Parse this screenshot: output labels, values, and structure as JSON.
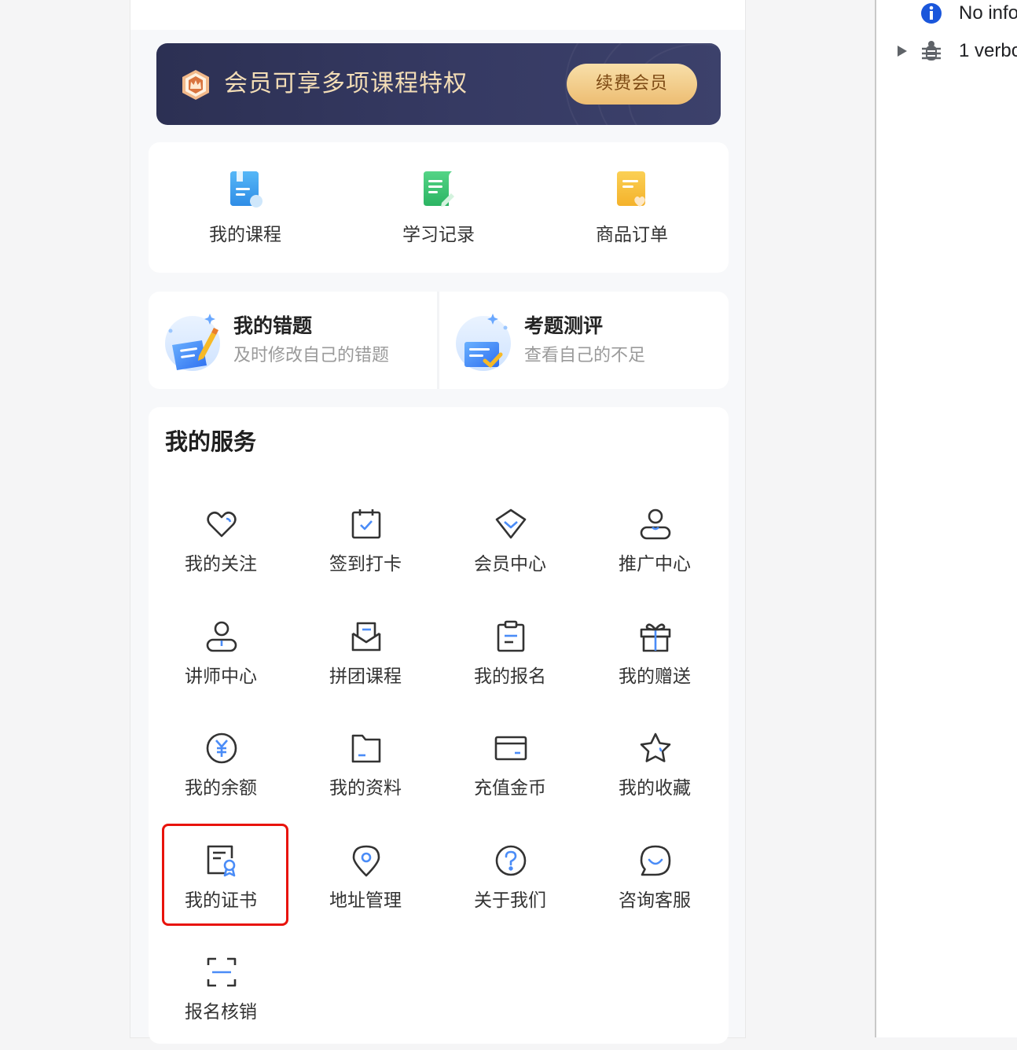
{
  "member_banner": {
    "text": "会员可享多项课程特权",
    "button": "续费会员"
  },
  "quick_entries": [
    {
      "label": "我的课程",
      "icon": "course-book-icon",
      "color": "#3aa0ee"
    },
    {
      "label": "学习记录",
      "icon": "study-record-icon",
      "color": "#3fc271"
    },
    {
      "label": "商品订单",
      "icon": "goods-order-icon",
      "color": "#f7bd3c"
    }
  ],
  "practice": [
    {
      "title": "我的错题",
      "subtitle": "及时修改自己的错题",
      "icon": "wrong-questions-icon"
    },
    {
      "title": "考题测评",
      "subtitle": "查看自己的不足",
      "icon": "exam-evaluation-icon"
    }
  ],
  "services": {
    "title": "我的服务",
    "items": [
      {
        "label": "我的关注",
        "icon": "heart-icon"
      },
      {
        "label": "签到打卡",
        "icon": "calendar-check-icon"
      },
      {
        "label": "会员中心",
        "icon": "diamond-icon"
      },
      {
        "label": "推广中心",
        "icon": "promoter-icon"
      },
      {
        "label": "讲师中心",
        "icon": "lecturer-icon"
      },
      {
        "label": "拼团课程",
        "icon": "group-envelope-icon"
      },
      {
        "label": "我的报名",
        "icon": "clipboard-icon"
      },
      {
        "label": "我的赠送",
        "icon": "gift-icon"
      },
      {
        "label": "我的余额",
        "icon": "yuan-coin-icon"
      },
      {
        "label": "我的资料",
        "icon": "folder-icon"
      },
      {
        "label": "充值金币",
        "icon": "card-icon"
      },
      {
        "label": "我的收藏",
        "icon": "star-icon"
      },
      {
        "label": "我的证书",
        "icon": "certificate-icon"
      },
      {
        "label": "地址管理",
        "icon": "location-pin-icon"
      },
      {
        "label": "关于我们",
        "icon": "question-icon"
      },
      {
        "label": "咨询客服",
        "icon": "chat-bubble-icon"
      },
      {
        "label": "报名核销",
        "icon": "scan-frame-icon"
      }
    ]
  },
  "devtools": {
    "info_text": "No info",
    "verbose_text": "1 verbo"
  },
  "colors": {
    "accent_blue": "#4a8cf7",
    "icon_dark": "#333333",
    "highlight_red": "#e8130c",
    "banner_gold": "#f3ddb6"
  }
}
